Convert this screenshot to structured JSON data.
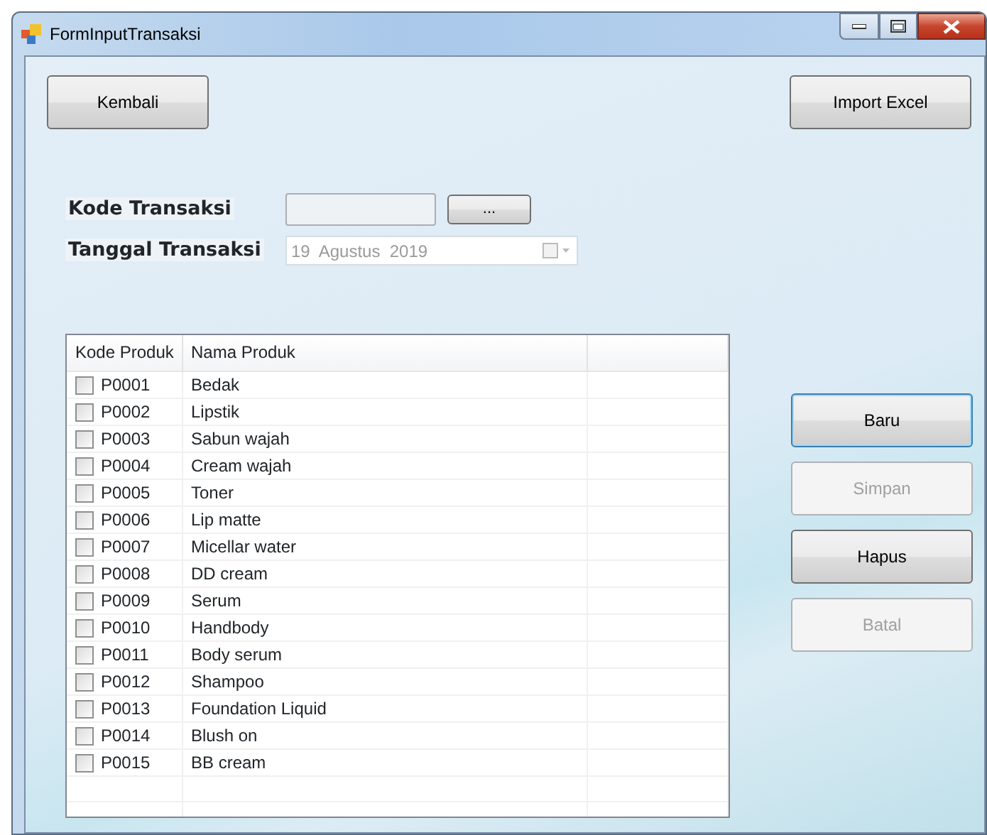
{
  "window": {
    "title": "FormInputTransaksi"
  },
  "top_buttons": [
    {
      "label": "Kembali",
      "disabled": false
    },
    {
      "label": "Import Excel",
      "disabled": false
    }
  ],
  "kode_transaksi": {
    "label": "Kode Transaksi",
    "browse_button": "...",
    "disabled": true
  },
  "tanggal_transaksi": {
    "label": "Tanggal Transaksi",
    "value": "19  Agustus  2019",
    "disabled": true
  },
  "table": {
    "columns": [
      "Kode Produk",
      "Nama Produk"
    ],
    "rows": [
      {
        "kode": "P0001",
        "nama": "Bedak",
        "checked": false
      },
      {
        "kode": "P0002",
        "nama": "Lipstik",
        "checked": false
      },
      {
        "kode": "P0003",
        "nama": "Sabun wajah",
        "checked": false
      },
      {
        "kode": "P0004",
        "nama": "Cream wajah",
        "checked": false
      },
      {
        "kode": "P0005",
        "nama": "Toner",
        "checked": false
      },
      {
        "kode": "P0006",
        "nama": "Lip matte",
        "checked": false
      },
      {
        "kode": "P0007",
        "nama": "Micellar water",
        "checked": false
      },
      {
        "kode": "P0008",
        "nama": "DD cream",
        "checked": false
      },
      {
        "kode": "P0009",
        "nama": "Serum",
        "checked": false
      },
      {
        "kode": "P0010",
        "nama": "Handbody",
        "checked": false
      },
      {
        "kode": "P0011",
        "nama": "Body serum",
        "checked": false
      },
      {
        "kode": "P0012",
        "nama": "Shampoo",
        "checked": false
      },
      {
        "kode": "P0013",
        "nama": "Foundation Liquid",
        "checked": false
      },
      {
        "kode": "P0014",
        "nama": "Blush on",
        "checked": false
      },
      {
        "kode": "P0015",
        "nama": "BB cream",
        "checked": false
      }
    ]
  },
  "side_buttons": [
    {
      "label": "Baru",
      "disabled": false,
      "focused": true
    },
    {
      "label": "Simpan",
      "disabled": true,
      "focused": false
    },
    {
      "label": "Hapus",
      "disabled": false,
      "focused": false
    },
    {
      "label": "Batal",
      "disabled": true,
      "focused": false
    }
  ]
}
